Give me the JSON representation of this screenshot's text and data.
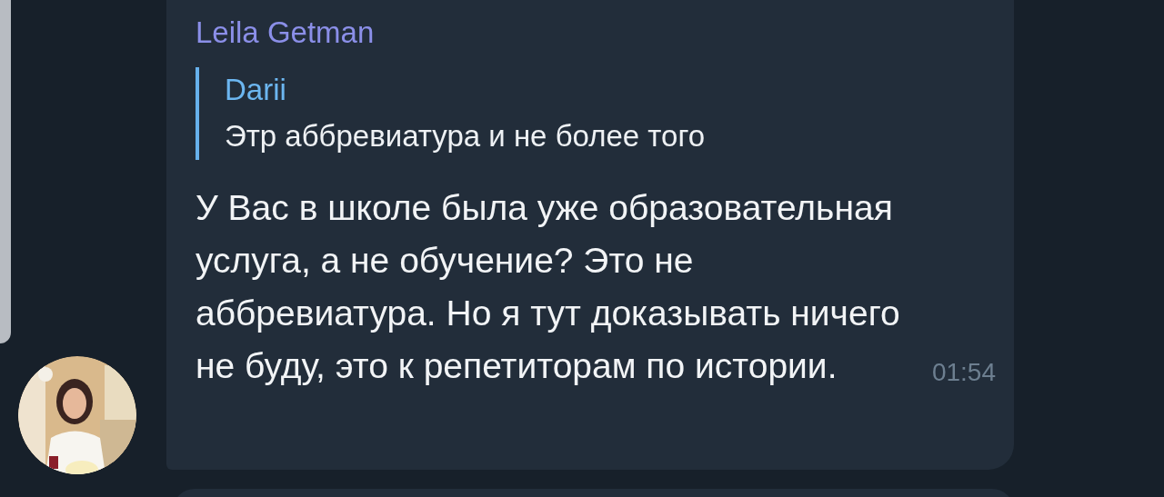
{
  "message": {
    "sender": "Leila Getman",
    "reply": {
      "author": "Darii",
      "text": "Этр аббревиатура и не более того"
    },
    "text": "У Вас в школе была уже образовательная услуга, а не обучение? Это не аббревиатура. Но я тут доказывать ничего не буду, это к репетиторам по истории.",
    "time": "01:54"
  }
}
